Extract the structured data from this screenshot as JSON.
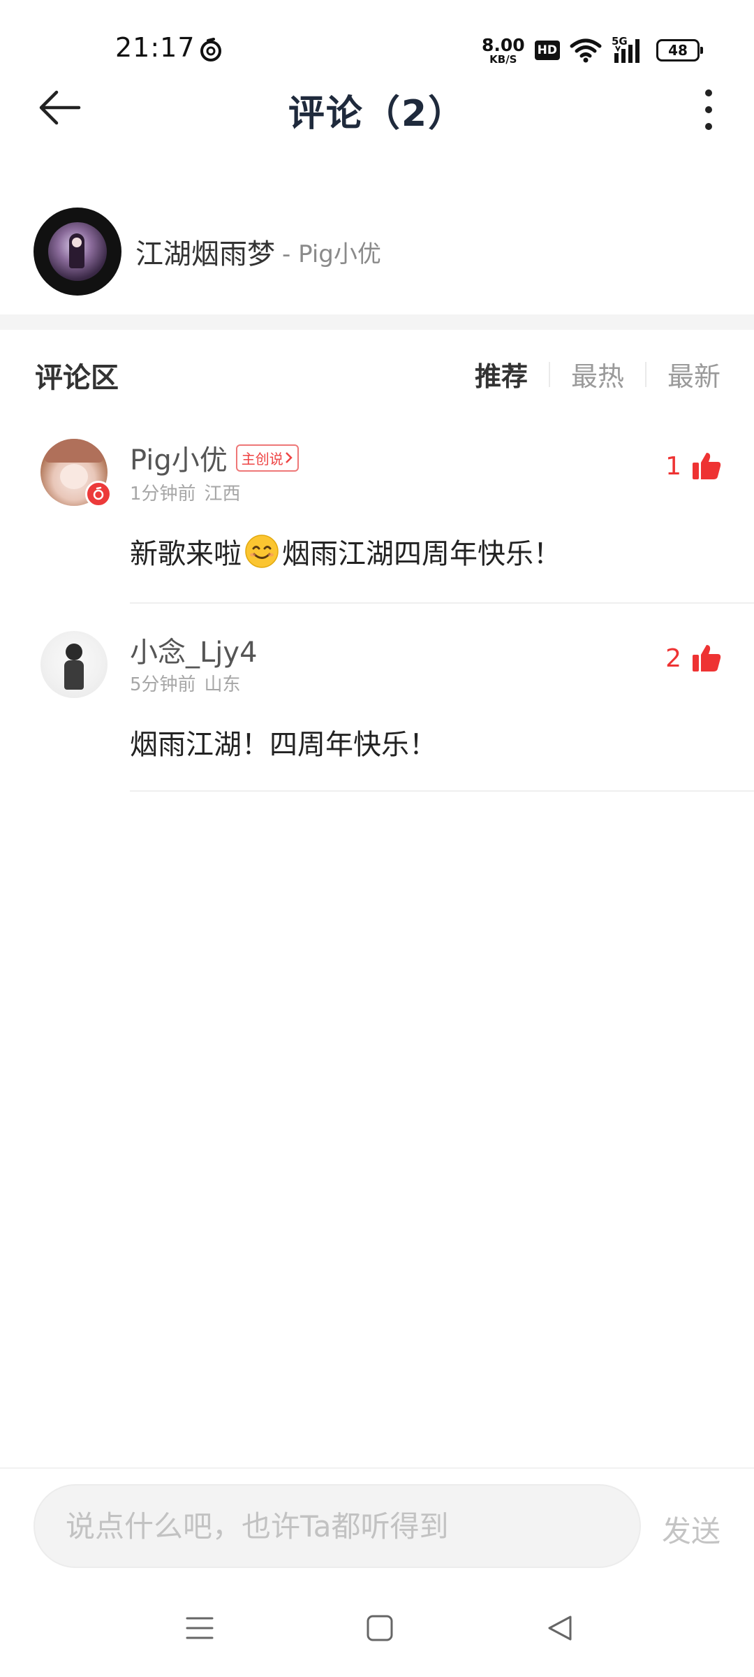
{
  "status_bar": {
    "time": "21:17",
    "net_speed_value": "8.00",
    "net_speed_unit": "KB/S",
    "hd": "HD",
    "network": "5G",
    "battery": "48"
  },
  "header": {
    "title": "评论（2）"
  },
  "song": {
    "title": "江湖烟雨梦",
    "artist": "- Pig小优"
  },
  "section": {
    "title": "评论区",
    "sort_tabs": [
      "推荐",
      "最热",
      "最新"
    ],
    "active_tab": "推荐"
  },
  "comments": [
    {
      "username": "Pig小优",
      "tag": "主创说",
      "time": "1分钟前",
      "location": "江西",
      "likes": "1",
      "text_before": "新歌来啦",
      "text_after": "烟雨江湖四周年快乐！"
    },
    {
      "username": "小念_Ljy4",
      "time": "5分钟前",
      "location": "山东",
      "likes": "2",
      "text": "烟雨江湖！四周年快乐！"
    }
  ],
  "input": {
    "placeholder": "说点什么吧，也许Ta都听得到",
    "send_label": "发送"
  },
  "colors": {
    "accent_red": "#ec3a3a",
    "title_dark": "#1f2a3c"
  }
}
